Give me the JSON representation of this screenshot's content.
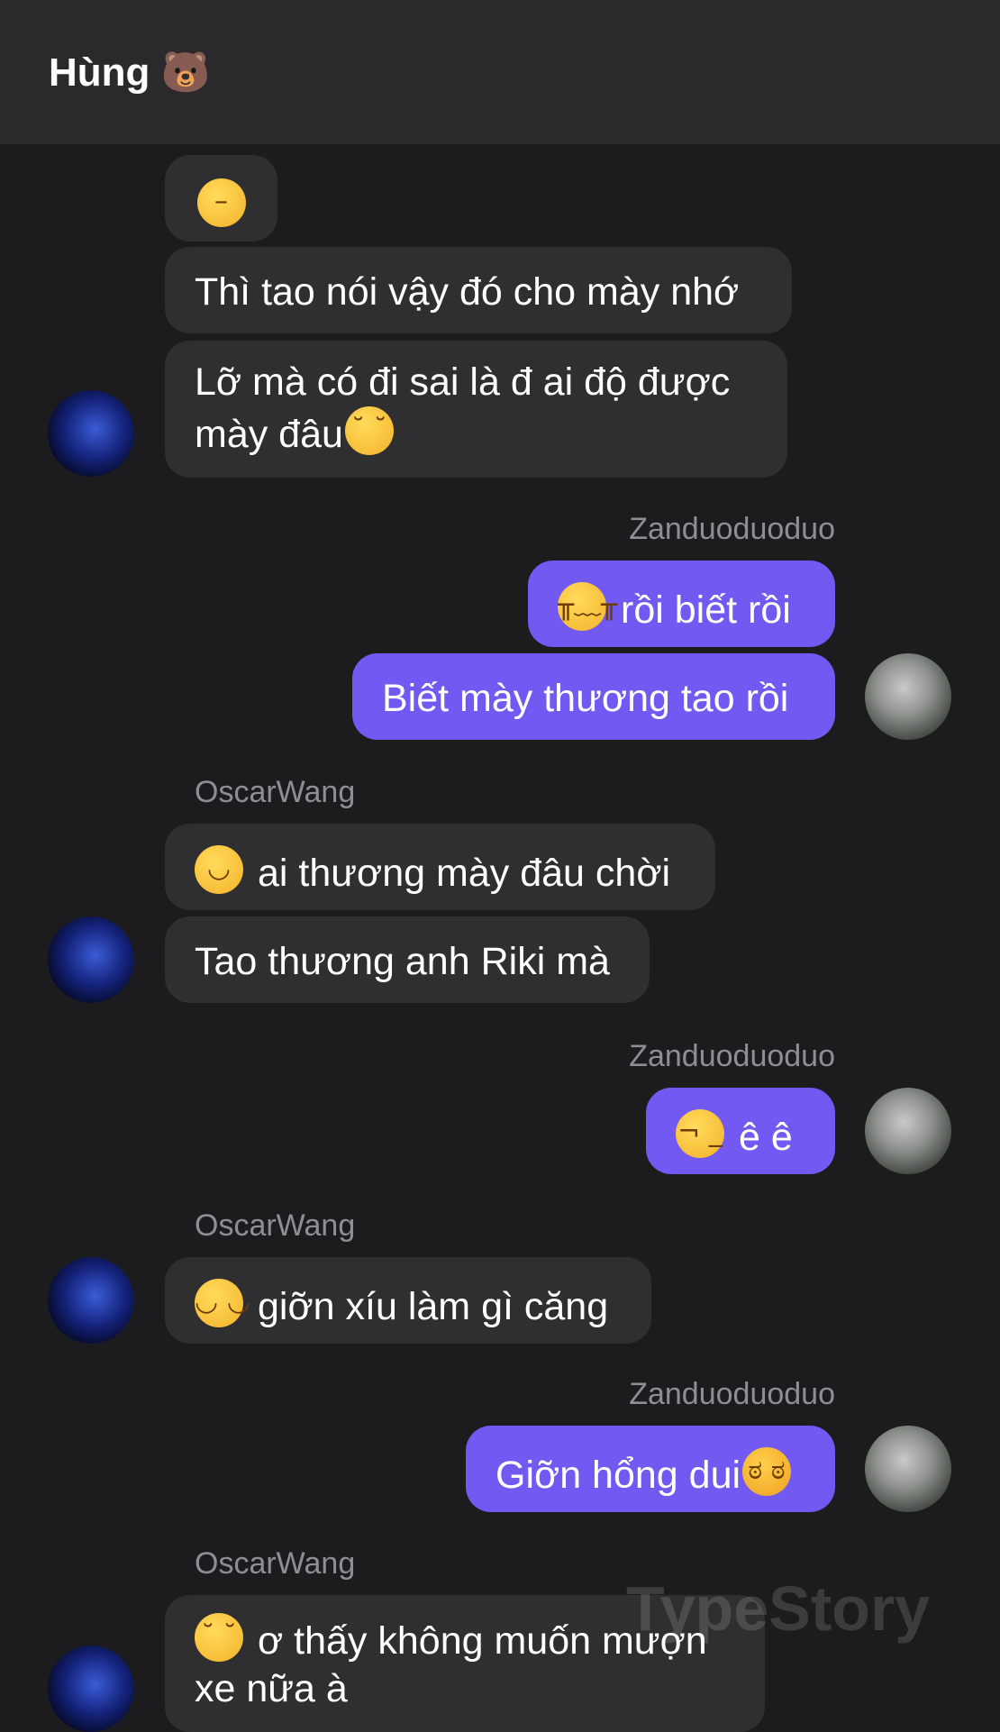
{
  "header": {
    "title": "Hùng",
    "title_emoji": "🐻"
  },
  "senders": {
    "me": "Zanduoduoduo",
    "them": "OscarWang"
  },
  "messages": [
    {
      "id": "m1",
      "side": "in",
      "emoji": "😑",
      "text": ""
    },
    {
      "id": "m2",
      "side": "in",
      "text": "Thì tao nói vậy đó cho mày nhớ"
    },
    {
      "id": "m3",
      "side": "in",
      "text": "Lỡ mà có đi sai là đ ai độ được mày đâu",
      "trailing_emoji": "😒"
    },
    {
      "id": "m4",
      "side": "out",
      "emoji": "😭",
      "text": "rồi biết rồi"
    },
    {
      "id": "m5",
      "side": "out",
      "text": "Biết mày thương tao rồi"
    },
    {
      "id": "m6",
      "side": "in",
      "emoji": "🙂",
      "text": "ai thương mày đâu chời"
    },
    {
      "id": "m7",
      "side": "in",
      "text": "Tao thương anh Riki mà"
    },
    {
      "id": "m8",
      "side": "out",
      "emoji": "🤨",
      "text": "ê ê"
    },
    {
      "id": "m9",
      "side": "in",
      "emoji": "😌",
      "text": "giỡn xíu làm gì căng"
    },
    {
      "id": "m10",
      "side": "out",
      "text": "Giỡn hổng dui",
      "trailing_emoji": "😠"
    },
    {
      "id": "m11",
      "side": "in",
      "emoji": "😒",
      "text": "ơ thấy không muốn mượn xe nữa à"
    }
  ],
  "watermark": "TypeStory",
  "colors": {
    "background": "#1c1c1e",
    "header": "#2a2a2c",
    "incoming_bubble": "#2f2f31",
    "outgoing_bubble": "#7259f2",
    "sender_label": "#8e8e93"
  }
}
